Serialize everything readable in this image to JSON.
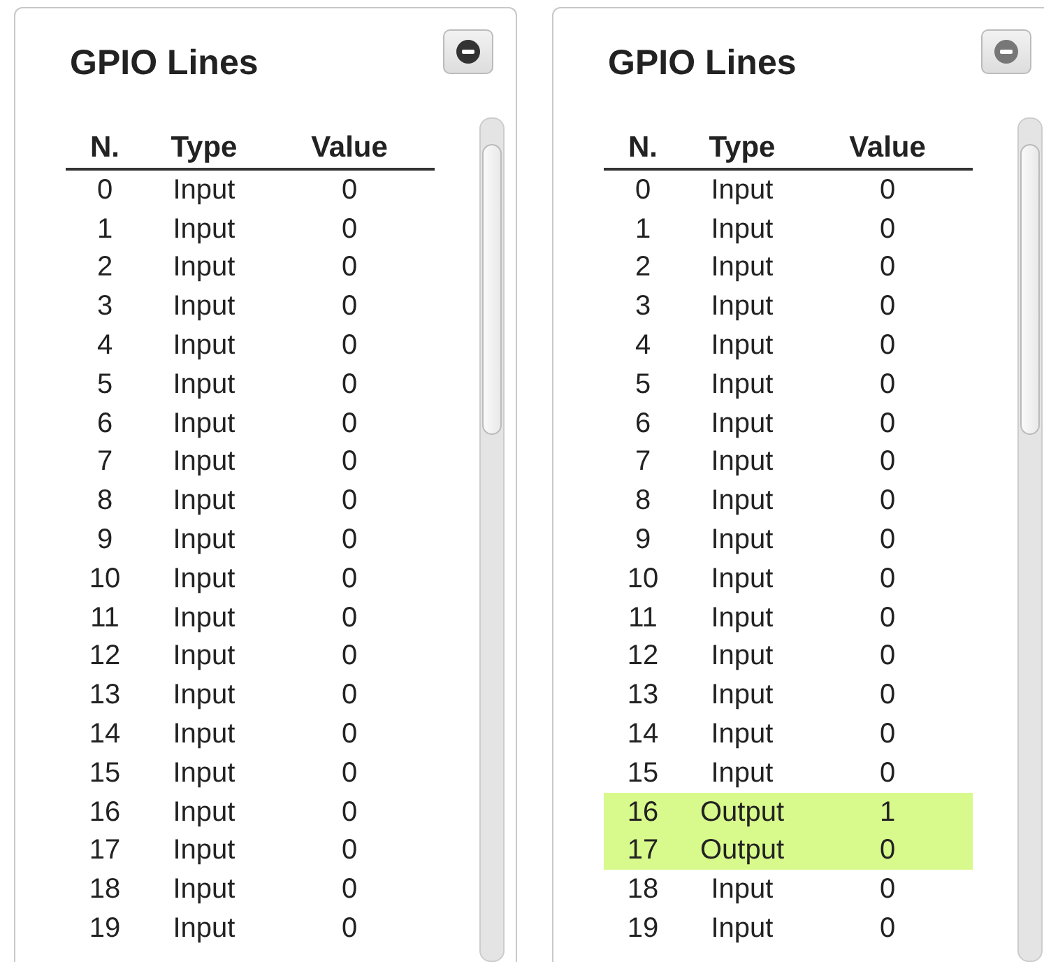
{
  "panels": [
    {
      "title": "GPIO Lines",
      "columns": [
        "N.",
        "Type",
        "Value"
      ],
      "rows": [
        {
          "n": "0",
          "type": "Input",
          "value": "0",
          "highlighted": false
        },
        {
          "n": "1",
          "type": "Input",
          "value": "0",
          "highlighted": false
        },
        {
          "n": "2",
          "type": "Input",
          "value": "0",
          "highlighted": false
        },
        {
          "n": "3",
          "type": "Input",
          "value": "0",
          "highlighted": false
        },
        {
          "n": "4",
          "type": "Input",
          "value": "0",
          "highlighted": false
        },
        {
          "n": "5",
          "type": "Input",
          "value": "0",
          "highlighted": false
        },
        {
          "n": "6",
          "type": "Input",
          "value": "0",
          "highlighted": false
        },
        {
          "n": "7",
          "type": "Input",
          "value": "0",
          "highlighted": false
        },
        {
          "n": "8",
          "type": "Input",
          "value": "0",
          "highlighted": false
        },
        {
          "n": "9",
          "type": "Input",
          "value": "0",
          "highlighted": false
        },
        {
          "n": "10",
          "type": "Input",
          "value": "0",
          "highlighted": false
        },
        {
          "n": "11",
          "type": "Input",
          "value": "0",
          "highlighted": false
        },
        {
          "n": "12",
          "type": "Input",
          "value": "0",
          "highlighted": false
        },
        {
          "n": "13",
          "type": "Input",
          "value": "0",
          "highlighted": false
        },
        {
          "n": "14",
          "type": "Input",
          "value": "0",
          "highlighted": false
        },
        {
          "n": "15",
          "type": "Input",
          "value": "0",
          "highlighted": false
        },
        {
          "n": "16",
          "type": "Input",
          "value": "0",
          "highlighted": false
        },
        {
          "n": "17",
          "type": "Input",
          "value": "0",
          "highlighted": false
        },
        {
          "n": "18",
          "type": "Input",
          "value": "0",
          "highlighted": false
        },
        {
          "n": "19",
          "type": "Input",
          "value": "0",
          "highlighted": false
        }
      ]
    },
    {
      "title": "GPIO Lines",
      "columns": [
        "N.",
        "Type",
        "Value"
      ],
      "rows": [
        {
          "n": "0",
          "type": "Input",
          "value": "0",
          "highlighted": false
        },
        {
          "n": "1",
          "type": "Input",
          "value": "0",
          "highlighted": false
        },
        {
          "n": "2",
          "type": "Input",
          "value": "0",
          "highlighted": false
        },
        {
          "n": "3",
          "type": "Input",
          "value": "0",
          "highlighted": false
        },
        {
          "n": "4",
          "type": "Input",
          "value": "0",
          "highlighted": false
        },
        {
          "n": "5",
          "type": "Input",
          "value": "0",
          "highlighted": false
        },
        {
          "n": "6",
          "type": "Input",
          "value": "0",
          "highlighted": false
        },
        {
          "n": "7",
          "type": "Input",
          "value": "0",
          "highlighted": false
        },
        {
          "n": "8",
          "type": "Input",
          "value": "0",
          "highlighted": false
        },
        {
          "n": "9",
          "type": "Input",
          "value": "0",
          "highlighted": false
        },
        {
          "n": "10",
          "type": "Input",
          "value": "0",
          "highlighted": false
        },
        {
          "n": "11",
          "type": "Input",
          "value": "0",
          "highlighted": false
        },
        {
          "n": "12",
          "type": "Input",
          "value": "0",
          "highlighted": false
        },
        {
          "n": "13",
          "type": "Input",
          "value": "0",
          "highlighted": false
        },
        {
          "n": "14",
          "type": "Input",
          "value": "0",
          "highlighted": false
        },
        {
          "n": "15",
          "type": "Input",
          "value": "0",
          "highlighted": false
        },
        {
          "n": "16",
          "type": "Output",
          "value": "1",
          "highlighted": true
        },
        {
          "n": "17",
          "type": "Output",
          "value": "0",
          "highlighted": true
        },
        {
          "n": "18",
          "type": "Input",
          "value": "0",
          "highlighted": false
        },
        {
          "n": "19",
          "type": "Input",
          "value": "0",
          "highlighted": false
        }
      ]
    }
  ]
}
